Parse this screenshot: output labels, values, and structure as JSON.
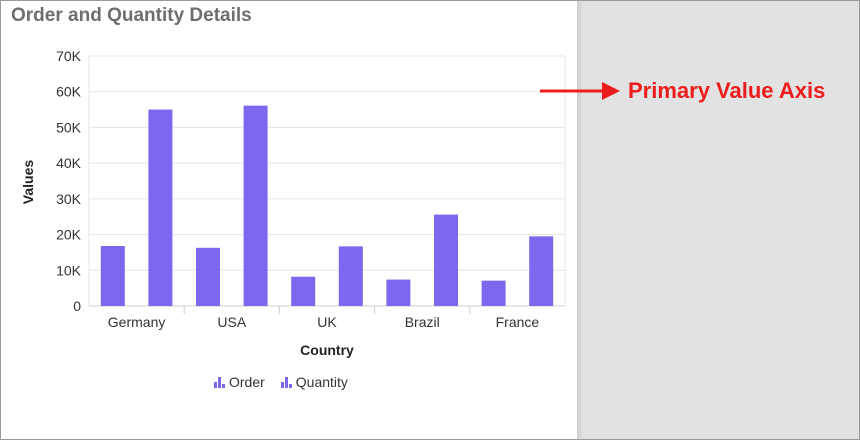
{
  "widget": {
    "title": "Order and Quantity Details"
  },
  "callout": {
    "text": "Primary Value Axis",
    "color": "#ee1c1c",
    "icon": "arrow-right-icon"
  },
  "legend": {
    "items": [
      {
        "label": "Order",
        "icon": "bar-chart-icon"
      },
      {
        "label": "Quantity",
        "icon": "bar-chart-icon"
      }
    ]
  },
  "chart_data": {
    "type": "bar",
    "title": "Order and Quantity Details",
    "xlabel": "Country",
    "ylabel": "Values",
    "categories": [
      "Germany",
      "USA",
      "UK",
      "Brazil",
      "France"
    ],
    "series": [
      {
        "name": "Order",
        "values": [
          16800,
          16300,
          8200,
          7400,
          7100
        ]
      },
      {
        "name": "Quantity",
        "values": [
          55000,
          56100,
          16700,
          25600,
          19500
        ]
      }
    ],
    "ylim": [
      0,
      70000
    ],
    "yticks": [
      0,
      10000,
      20000,
      30000,
      40000,
      50000,
      60000,
      70000
    ],
    "ytick_labels": [
      "0",
      "10K",
      "20K",
      "30K",
      "40K",
      "50K",
      "60K",
      "70K"
    ],
    "grid": true,
    "legend_position": "bottom",
    "bar_color": "#7b68ee"
  }
}
